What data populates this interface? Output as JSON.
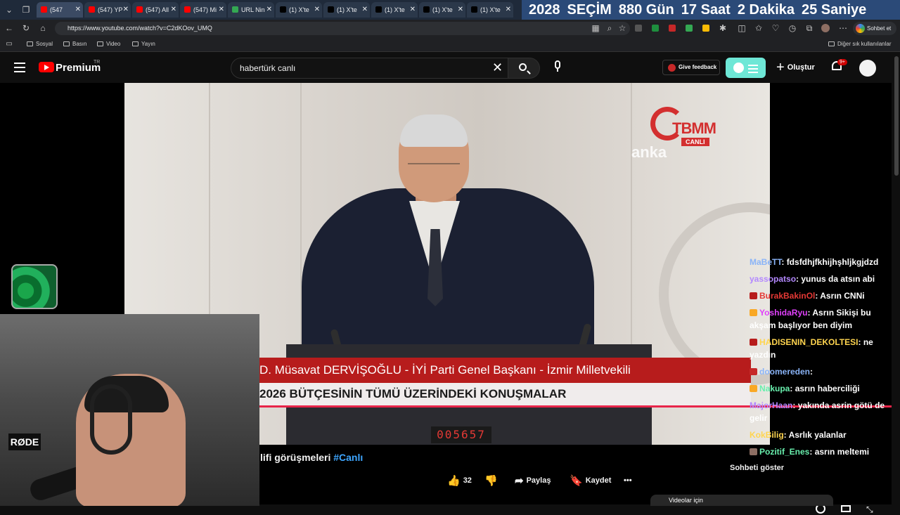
{
  "browser": {
    "tabs": [
      {
        "label": "(547",
        "color": "#ff0000"
      },
      {
        "label": "(547) YP",
        "color": "#ff0000"
      },
      {
        "label": "(547) All",
        "color": "#ff0000"
      },
      {
        "label": "(547) Mi",
        "color": "#ff0000"
      },
      {
        "label": "URL Nin",
        "color": "#34a853"
      },
      {
        "label": "(1) X'te",
        "color": "#000000"
      },
      {
        "label": "(1) X'te",
        "color": "#000000"
      },
      {
        "label": "(1) X'te",
        "color": "#000000"
      },
      {
        "label": "(1) X'te",
        "color": "#000000"
      },
      {
        "label": "(1) X'te",
        "color": "#000000"
      }
    ],
    "countdown": [
      "2028",
      "SEÇİM",
      "880 Gün",
      "17 Saat",
      "2 Dakika",
      "25 Saniye"
    ],
    "url": "https://www.youtube.com/watch?v=C2dKOov_UMQ",
    "chat_button": "Sohbet et",
    "bookmarks": [
      "Sosyal",
      "Basın",
      "Video",
      "Yayın"
    ],
    "other_bookmarks": "Diğer sık kullanılanlar"
  },
  "youtube": {
    "logo": "Premium",
    "country": "TR",
    "search_value": "habertürk canlı",
    "feedback_label": "Give feedback",
    "create_label": "Oluştur",
    "notif_count": "9+"
  },
  "video": {
    "channel_bug": "TBMM",
    "channel_live": "CANLI",
    "agency": "anka",
    "lower_third_1": "D. Müsavat DERVİŞOĞLU - İYİ Parti Genel Başkanı - İzmir Milletvekili",
    "lower_third_2": "2026 BÜTÇESİNİN TÜMÜ ÜZERİNDEKİ KONUŞMALAR",
    "counter": "005657",
    "mic_brand": "RØDE"
  },
  "chat": [
    {
      "user": "MaBeTT",
      "text": "fdsfdhjfkhijhşhljkgjdzd",
      "color": "#8ab4f8",
      "badge": ""
    },
    {
      "user": "yassopatso",
      "text": "yunus da atsın abi",
      "color": "#b388ff",
      "badge": ""
    },
    {
      "user": "BurakBakinOl",
      "text": "Asrın CNNi",
      "color": "#e53935",
      "badge": "#b71c1c"
    },
    {
      "user": "YoshidaRyu",
      "text": "Asrın Sikişi bu akşam başlıyor ben diyim",
      "color": "#e040fb",
      "badge": "#f9a825"
    },
    {
      "user": "HADISENIN_DEKOLTESI",
      "text": "ne yazdın",
      "color": "#ffd54f",
      "badge": "#b71c1c"
    },
    {
      "user": "doomereden",
      "text": "",
      "color": "#8ab4f8",
      "badge": "#c62828"
    },
    {
      "user": "Nakupa",
      "text": "asrın haberciliği",
      "color": "#69f0ae",
      "badge": "#f9a825"
    },
    {
      "user": "MajorHaan",
      "text": "yakında asrin götü de gelir",
      "color": "#b388ff",
      "badge": ""
    },
    {
      "user": "KokBilig",
      "text": "Asrlık yalanlar",
      "color": "#ffd54f",
      "badge": ""
    },
    {
      "user": "Pozitif_Enes",
      "text": "asrın meltemi",
      "color": "#69f0ae",
      "badge": "#8d6e63"
    }
  ],
  "below": {
    "title_text": "lifi görüşmeleri",
    "title_tag": "#Canlı",
    "like_count": "32",
    "share_label": "Paylaş",
    "save_label": "Kaydet",
    "more_label": "•••",
    "show_chat": "Sohbeti göster",
    "bottom_strip": "Videolar için"
  }
}
